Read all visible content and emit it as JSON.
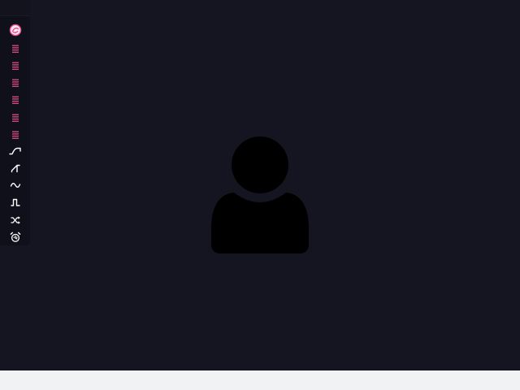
{
  "colors": {
    "background": "#141520",
    "sidebar": "#0f1019",
    "accent_pink": "#e44b8d",
    "icon_white": "#ffffff",
    "avatar": "#000000",
    "bottom_strip": "#f1f2f3"
  },
  "sidebar": {
    "tools": [
      {
        "icon": "palette-icon"
      },
      {
        "icon": "layer-lines-icon"
      },
      {
        "icon": "layer-lines-icon"
      },
      {
        "icon": "layer-lines-icon"
      },
      {
        "icon": "layer-lines-icon"
      },
      {
        "icon": "layer-lines-icon"
      },
      {
        "icon": "layer-lines-icon"
      },
      {
        "icon": "envelope-wave-icon"
      },
      {
        "icon": "sawtooth-wave-icon"
      },
      {
        "icon": "sine-wave-icon"
      },
      {
        "icon": "square-wave-icon"
      },
      {
        "icon": "shuffle-icon"
      },
      {
        "icon": "alarm-clock-icon"
      }
    ]
  },
  "main": {
    "avatar_icon": "user-silhouette-icon"
  }
}
